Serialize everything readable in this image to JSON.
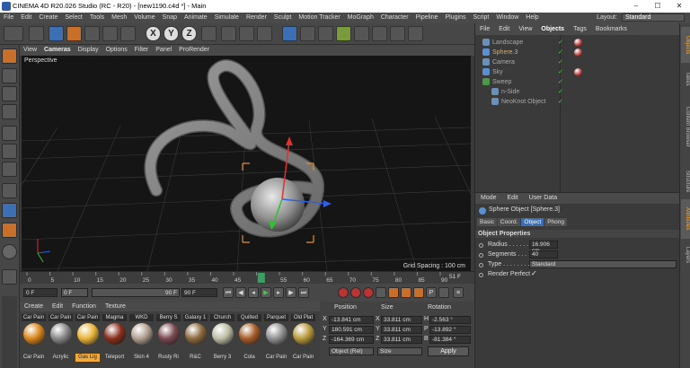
{
  "window": {
    "title": "CINEMA 4D R20.026 Studio (RC - R20) - [new1190.c4d *] - Main"
  },
  "menubar": {
    "items": [
      "File",
      "Edit",
      "Create",
      "Select",
      "Tools",
      "Mesh",
      "Volume",
      "Snap",
      "Animate",
      "Simulate",
      "Render",
      "Sculpt",
      "Motion Tracker",
      "MoGraph",
      "Character",
      "Pipeline",
      "Plugins",
      "Script",
      "Window",
      "Help"
    ],
    "layout_label": "Layout:",
    "layout_value": "Standard"
  },
  "viewport": {
    "menu": [
      "View",
      "Cameras",
      "Display",
      "Options",
      "Filter",
      "Panel",
      "ProRender"
    ],
    "label": "Perspective",
    "grid_spacing": "Grid Spacing : 100 cm"
  },
  "timeline": {
    "ticks": [
      "0",
      "5",
      "10",
      "15",
      "20",
      "25",
      "30",
      "35",
      "40",
      "45",
      "50",
      "55",
      "60",
      "65",
      "70",
      "75",
      "80",
      "85",
      "90"
    ],
    "current_frame": "51",
    "end_label": "51 F",
    "current_fraction": 0.567
  },
  "transport": {
    "start": "0 F",
    "current": "0 F",
    "end_a": "90 F",
    "end_b": "90 F"
  },
  "materials": {
    "menu": [
      "Create",
      "Edit",
      "Function",
      "Texture"
    ],
    "top_names": [
      "Car Pain",
      "Car Pain",
      "Car Pain",
      "Magma",
      "WKD",
      "Berry S",
      "Galaxy 1",
      "Church",
      "Quilted",
      "Parquet",
      "Old Plat"
    ],
    "bottom_names": [
      "Car Pain",
      "Acrylic",
      "Gas Lig",
      "Teleport",
      "Skin 4",
      "Rusty Ri",
      "R&C",
      "Berry 3",
      "Cola",
      "Car Pain",
      "Car Pain"
    ],
    "colors": [
      "#d8861c",
      "#888888",
      "#e8b43a",
      "#8a2f1e",
      "#b0a090",
      "#7a4a52",
      "#8c6a3f",
      "#bcbca5",
      "#a65c2a",
      "#909090",
      "#b89a3c"
    ]
  },
  "coords": {
    "headers": [
      "Position",
      "Size",
      "Rotation"
    ],
    "rows": [
      {
        "axis": "X",
        "pos": "-13.841 cm",
        "size": "33.811 cm",
        "rlabel": "H",
        "rot": "-2.563 °"
      },
      {
        "axis": "Y",
        "pos": "180.591 cm",
        "size": "33.811 cm",
        "rlabel": "P",
        "rot": "-13.892 °"
      },
      {
        "axis": "Z",
        "pos": "-164.369 cm",
        "size": "33.811 cm",
        "rlabel": "B",
        "rot": "-81.384 °"
      }
    ],
    "mode_select": "Object (Rel)",
    "size_select": "Size",
    "apply": "Apply"
  },
  "objects": {
    "menu": [
      "File",
      "Edit",
      "View",
      "Objects",
      "Tags",
      "Bookmarks"
    ],
    "items": [
      {
        "name": "Landscape",
        "indent": 0,
        "color": "#aaaaaa"
      },
      {
        "name": "Sphere.3",
        "indent": 0,
        "color": "#f3a93a"
      },
      {
        "name": "Camera",
        "indent": 0,
        "color": "#aaaaaa"
      },
      {
        "name": "Sky",
        "indent": 0,
        "color": "#aaaaaa"
      },
      {
        "name": "Sweep",
        "indent": 0,
        "color": "#aaaaaa"
      },
      {
        "name": "n-Side",
        "indent": 1,
        "color": "#aaaaaa"
      },
      {
        "name": "NeoKnot Object",
        "indent": 1,
        "color": "#aaaaaa"
      }
    ]
  },
  "right_tabs": [
    "Objects",
    "Takes",
    "Content Browser",
    "Structure",
    "Attributes",
    "Layers"
  ],
  "attributes": {
    "menu": [
      "Mode",
      "Edit",
      "User Data"
    ],
    "title": "Sphere Object [Sphere.3]",
    "tabs": [
      "Basic",
      "Coord.",
      "Object",
      "Phong"
    ],
    "section": "Object Properties",
    "props": [
      {
        "label": "Radius . . . . . .",
        "value": "16.906 cm"
      },
      {
        "label": "Segments . . .",
        "value": "40"
      },
      {
        "label": "Type . . . . . . . .",
        "value": "Standard"
      },
      {
        "label": "Render Perfect",
        "value": "✓"
      }
    ]
  }
}
